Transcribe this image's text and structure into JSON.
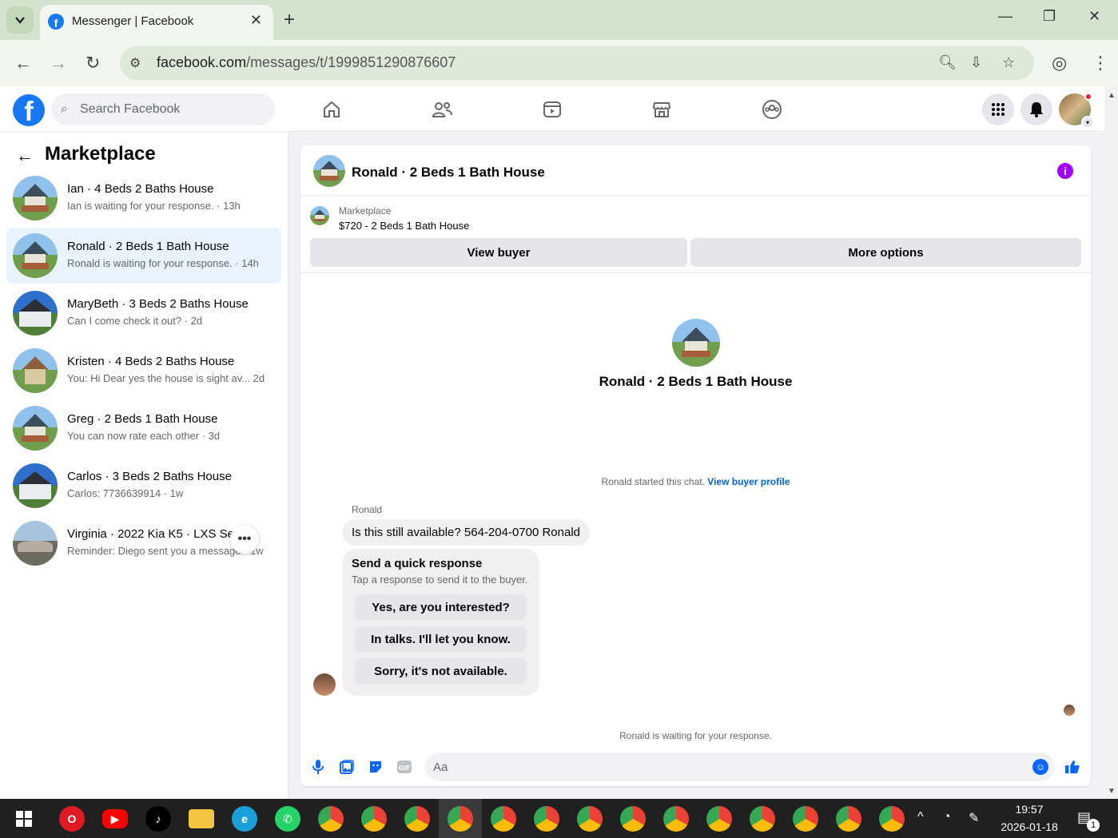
{
  "browser": {
    "tab_title": "Messenger | Facebook",
    "url_host": "facebook.com",
    "url_path": "/messages/t/1999851290876607"
  },
  "facebook": {
    "search_placeholder": "Search Facebook",
    "nav_icons": [
      "home-icon",
      "friends-icon",
      "video-icon",
      "marketplace-icon",
      "groups-icon"
    ],
    "brand_color": "#1877f2"
  },
  "sidebar": {
    "title": "Marketplace",
    "conversations": [
      {
        "name": "Ian · 4 Beds 2 Baths House",
        "preview": "Ian is waiting for your response. · 13h",
        "thumb": "house"
      },
      {
        "name": "Ronald · 2 Beds 1 Bath House",
        "preview": "Ronald is waiting for your response. · 14h",
        "thumb": "house",
        "active": true
      },
      {
        "name": "MaryBeth · 3 Beds 2 Baths House",
        "preview": "Can I come check it out? · 2d",
        "thumb": "house-blue"
      },
      {
        "name": "Kristen · 4 Beds 2 Baths House",
        "preview": "You: Hi Dear yes the house is sight av...   2d",
        "thumb": "house"
      },
      {
        "name": "Greg · 2 Beds 1 Bath House",
        "preview": "You can now rate each other · 3d",
        "thumb": "house"
      },
      {
        "name": "Carlos · 3 Beds 2 Baths House",
        "preview": "Carlos: 7736639914 · 1w",
        "thumb": "house-blue"
      },
      {
        "name": "Virginia · 2022 Kia K5 · LXS Sed...",
        "preview": "Reminder: Diego sent you a message · 1w",
        "thumb": "car"
      }
    ]
  },
  "chat": {
    "header_title": "Ronald · 2 Beds 1 Bath House",
    "listing_category": "Marketplace",
    "listing_price_title": "$720 - 2 Beds 1 Bath House",
    "view_buyer_label": "View buyer",
    "more_options_label": "More options",
    "intro_name": "Ronald · 2 Beds 1 Bath House",
    "started_text": "Ronald started this chat.",
    "view_profile_link": "View buyer profile",
    "sender_name": "Ronald",
    "message": "Is this still available? 564-204-0700 Ronald",
    "quick_title": "Send a quick response",
    "quick_subtitle": "Tap a response to send it to the buyer.",
    "quick_replies": [
      "Yes, are you interested?",
      "In talks. I'll let you know.",
      "Sorry, it's not available."
    ],
    "waiting_text": "Ronald is waiting for your response.",
    "composer_placeholder": "Aa",
    "accent_color": "#0866ff"
  },
  "taskbar": {
    "time": "19:57",
    "date": "2026-01-18",
    "notification_count": "1"
  }
}
